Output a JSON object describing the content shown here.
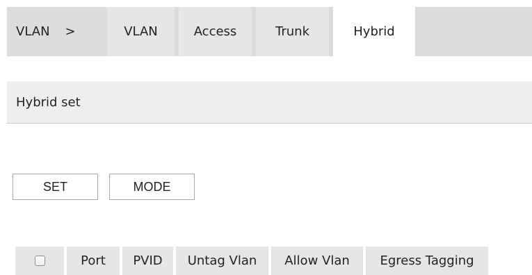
{
  "breadcrumb": {
    "root": "VLAN",
    "separator": ">"
  },
  "tabs": [
    {
      "label": "VLAN",
      "active": false
    },
    {
      "label": "Access",
      "active": false
    },
    {
      "label": "Trunk",
      "active": false
    },
    {
      "label": "Hybrid",
      "active": true
    }
  ],
  "section": {
    "title": "Hybrid set"
  },
  "buttons": {
    "set": "SET",
    "mode": "MODE"
  },
  "table": {
    "headers": [
      "Port",
      "PVID",
      "Untag Vlan",
      "Allow Vlan",
      "Egress Tagging"
    ],
    "select_all_checked": false
  },
  "colors": {
    "tabbar_bg": "#dcdcdc",
    "tab_bg": "#e6e6e6",
    "active_tab_bg": "#ffffff",
    "section_bg": "#eeeeee"
  }
}
